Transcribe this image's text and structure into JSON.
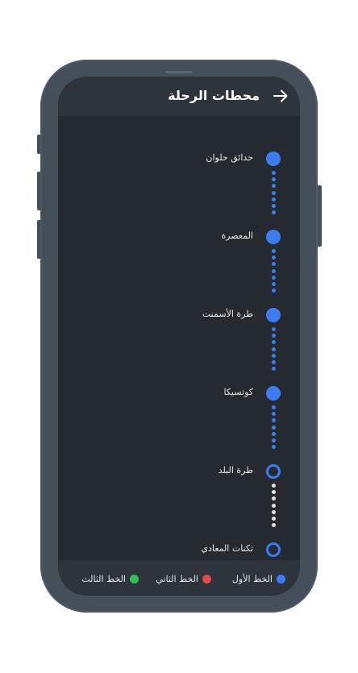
{
  "header": {
    "title": "محطات الرحلة",
    "back_icon": "arrow-right-icon"
  },
  "stations": [
    {
      "name": "حدائق حلوان",
      "marker": "filled"
    },
    {
      "name": "المعصرة",
      "marker": "filled"
    },
    {
      "name": "طرة الأسمنت",
      "marker": "filled"
    },
    {
      "name": "كوتسيكا",
      "marker": "filled"
    },
    {
      "name": "طرة البلد",
      "marker": "hollow"
    },
    {
      "name": "ثكنات المعادي",
      "marker": "hollow"
    }
  ],
  "legend": [
    {
      "label": "الخط الأول",
      "color": "#3d7bf2"
    },
    {
      "label": "الخط الثاني",
      "color": "#e5484d"
    },
    {
      "label": "الخط الثالث",
      "color": "#2fbf57"
    }
  ],
  "colors": {
    "accent": "#3d7bf2",
    "screen_bg": "#252930",
    "header_bg": "#2e343b",
    "phone_frame": "#454f59"
  }
}
